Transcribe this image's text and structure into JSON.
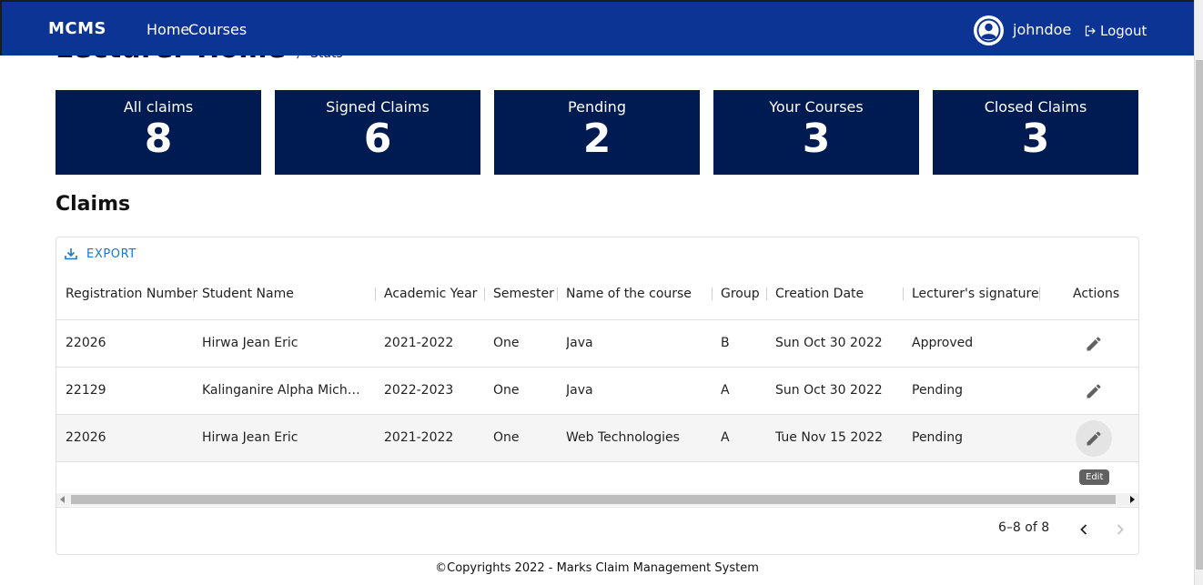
{
  "page": {
    "heading": "Lecturer Home",
    "breadcrumb_sep": "/",
    "breadcrumb": "Stats"
  },
  "navbar": {
    "brand": "MCMS",
    "home": "Home",
    "courses": "Courses",
    "username": "johndoe",
    "logout": "Logout"
  },
  "stats": [
    {
      "label": "All claims",
      "value": "8"
    },
    {
      "label": "Signed Claims",
      "value": "6"
    },
    {
      "label": "Pending",
      "value": "2"
    },
    {
      "label": "Your Courses",
      "value": "3"
    },
    {
      "label": "Closed Claims",
      "value": "3"
    }
  ],
  "claims": {
    "title": "Claims",
    "export_label": "EXPORT",
    "columns": [
      "Registration Number",
      "Student Name",
      "Academic Year",
      "Semester",
      "Name of the course",
      "Group",
      "Creation Date",
      "Lecturer's signature",
      "Actions"
    ],
    "rows": [
      {
        "reg": "22026",
        "student": "Hirwa Jean Eric",
        "year": "2021-2022",
        "semester": "One",
        "course": "Java",
        "group": "B",
        "date": "Sun Oct 30 2022",
        "signature": "Approved"
      },
      {
        "reg": "22129",
        "student": "Kalinganire Alpha Michela…",
        "year": "2022-2023",
        "semester": "One",
        "course": "Java",
        "group": "A",
        "date": "Sun Oct 30 2022",
        "signature": "Pending"
      },
      {
        "reg": "22026",
        "student": "Hirwa Jean Eric",
        "year": "2021-2022",
        "semester": "One",
        "course": "Web Technologies",
        "group": "A",
        "date": "Tue Nov 15 2022",
        "signature": "Pending"
      }
    ],
    "tooltip": "Edit",
    "pagination": "6–8 of 8"
  },
  "footer": {
    "copyright": "©Copyrights 2022 - Marks Claim Management System"
  },
  "colors": {
    "navbar": "#0c3494",
    "stat_card": "#001a52",
    "accent": "#1976d2"
  }
}
